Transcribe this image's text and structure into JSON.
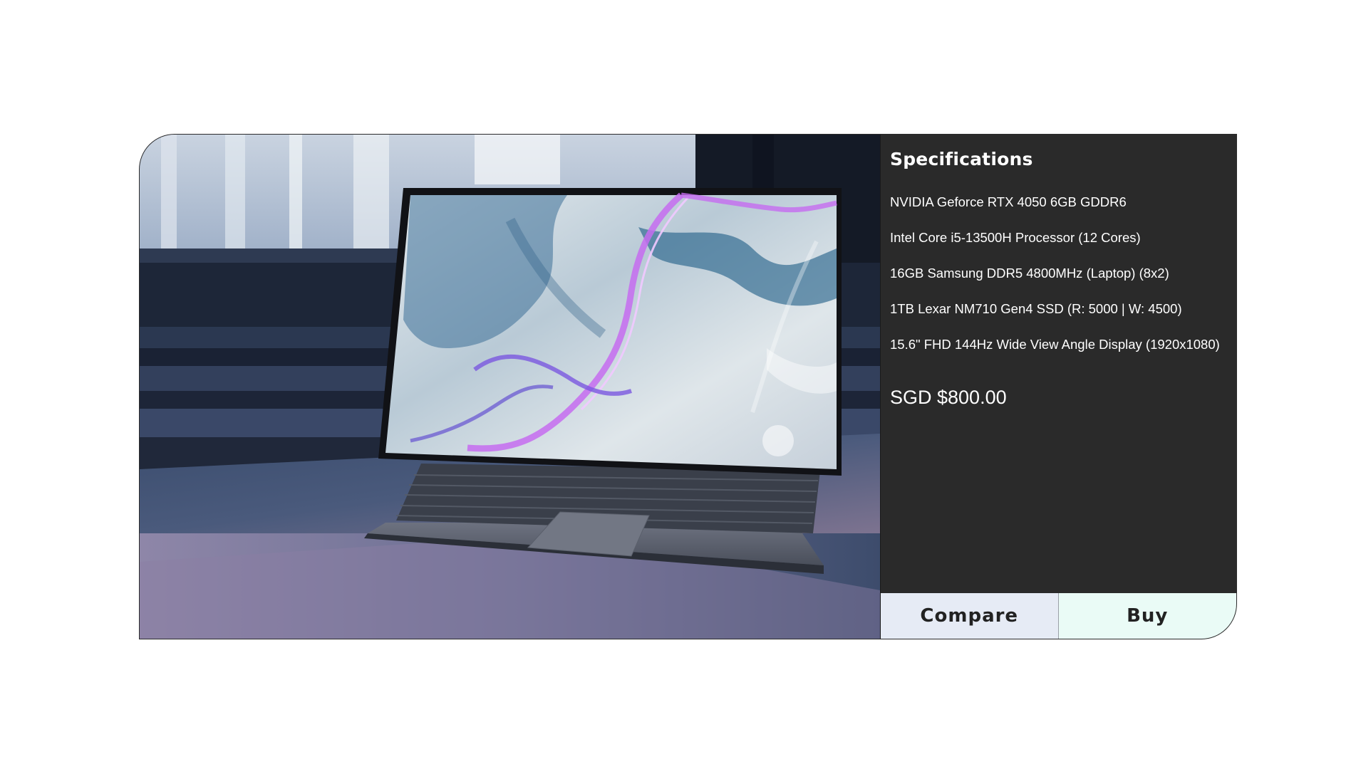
{
  "product": {
    "image_alt": "Laptop on a stone windowsill",
    "specs_title": "Specifications",
    "specs": [
      "NVIDIA Geforce RTX 4050 6GB GDDR6",
      "Intel Core i5-13500H Processor (12 Cores)",
      "16GB Samsung DDR5 4800MHz (Laptop) (8x2)",
      "1TB Lexar NM710 Gen4 SSD (R: 5000 | W: 4500)",
      "15.6\" FHD 144Hz Wide View Angle Display (1920x1080)"
    ],
    "price": "SGD $800.00"
  },
  "actions": {
    "compare_label": "Compare",
    "buy_label": "Buy"
  },
  "colors": {
    "panel_bg": "#2a2a2a",
    "compare_bg": "#e6ebf5",
    "buy_bg": "#eafbf6",
    "button_text": "#222222"
  }
}
